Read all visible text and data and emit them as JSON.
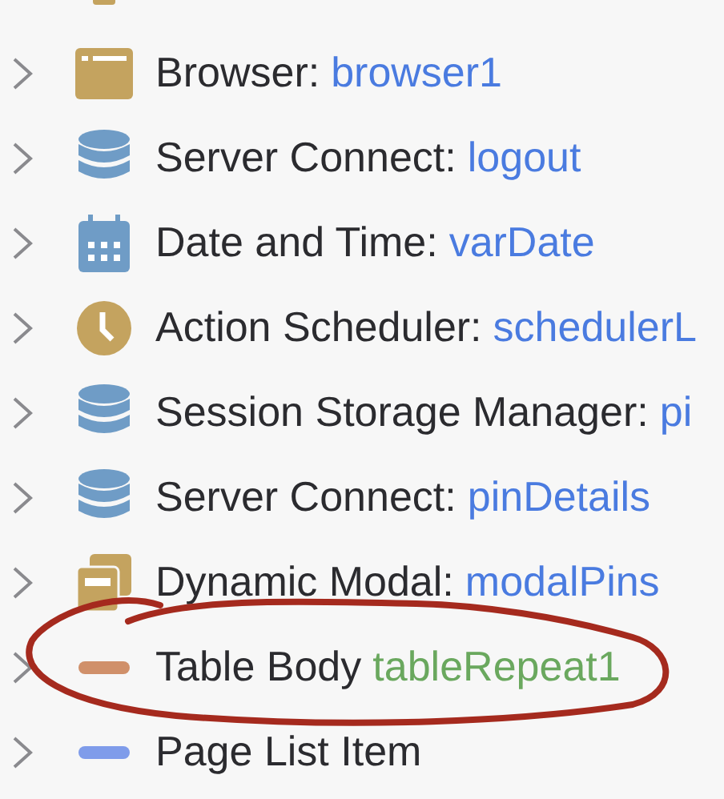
{
  "tree": {
    "items": [
      {
        "kind": "pin"
      },
      {
        "kind": "browser",
        "label": "Browser:",
        "name": "browser1",
        "color": "#4a7be0",
        "expandable": true
      },
      {
        "kind": "database",
        "label": "Server Connect:",
        "name": "logout",
        "color": "#4a7be0",
        "expandable": true
      },
      {
        "kind": "calendar",
        "label": "Date and Time:",
        "name": "varDate",
        "color": "#4a7be0",
        "expandable": true
      },
      {
        "kind": "clock",
        "label": "Action Scheduler:",
        "name": "schedulerL",
        "color": "#4a7be0",
        "expandable": true
      },
      {
        "kind": "database",
        "label": "Session Storage Manager:",
        "name": "pi",
        "color": "#4a7be0",
        "expandable": true
      },
      {
        "kind": "database",
        "label": "Server Connect:",
        "name": "pinDetails",
        "color": "#4a7be0",
        "expandable": true
      },
      {
        "kind": "modal",
        "label": "Dynamic Modal:",
        "name": "modalPins",
        "color": "#4a7be0",
        "expandable": true
      },
      {
        "kind": "table-body",
        "label": "Table Body",
        "name": "tableRepeat1",
        "color": "#6aa85e",
        "expandable": true
      },
      {
        "kind": "list-item",
        "label": "Page List Item",
        "expandable": true
      }
    ]
  },
  "annotation": {
    "kind": "freehand-circle"
  }
}
